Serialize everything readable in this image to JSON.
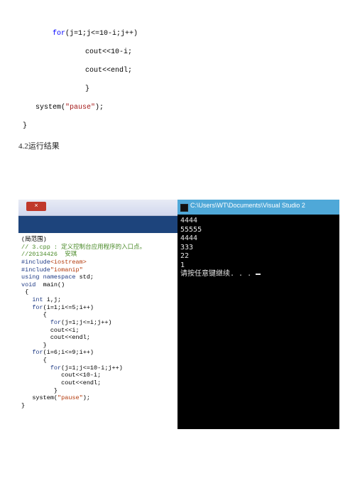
{
  "fragment": {
    "l1": "for(j=1;j<=10-i;j++)",
    "l2": "cout<<10-i;",
    "l3": "cout<<endl;",
    "l4": "}",
    "l5": "system(\"pause\");",
    "l6": "}",
    "l5_a": "system(",
    "l5_b": "\"pause\"",
    "l5_c": ");"
  },
  "section": {
    "label": "4.2运行结果"
  },
  "editor": {
    "close_glyph": "×",
    "line_tab": "(局范围)",
    "cmt1": "// 3.cpp : 定义控制台应用程序的入口点。",
    "cmt2": "//20134426  安琪",
    "inc1_a": "#include",
    "inc1_b": "<iostream>",
    "inc2_a": "#include",
    "inc2_b": "\"iomanip\"",
    "using_a": "using",
    "using_b": " namespace",
    "using_c": " std;",
    "main_a": "void",
    "main_b": "  main()",
    "l_bo": " {",
    "decl_a": "int",
    "decl_b": " i,j;",
    "for1_a": "for",
    "for1_b": "(i=1;i<=5;i++)",
    "bo": "{",
    "for2_a": "for",
    "for2_b": "(j=1;j<=i;j++)",
    "c_i": "cout<<i;",
    "c_end": "cout<<endl;",
    "bc": "}",
    "for3_a": "for",
    "for3_b": "(i=6;i<=9;i++)",
    "for4_a": "for",
    "for4_b": "(j=1;j<=10-i;j++)",
    "c_10mi": "cout<<10-i;",
    "sys_a": "system(",
    "sys_b": "\"pause\"",
    "sys_c": ");",
    "bc_end": "}"
  },
  "console": {
    "title": "C:\\Users\\WT\\Documents\\Visual Studio 2",
    "l1": "4444",
    "l2": "55555",
    "l3": "4444",
    "l4": "333",
    "l5": "22",
    "l6": "1",
    "prompt_a": "请按任意键继续. . . "
  }
}
